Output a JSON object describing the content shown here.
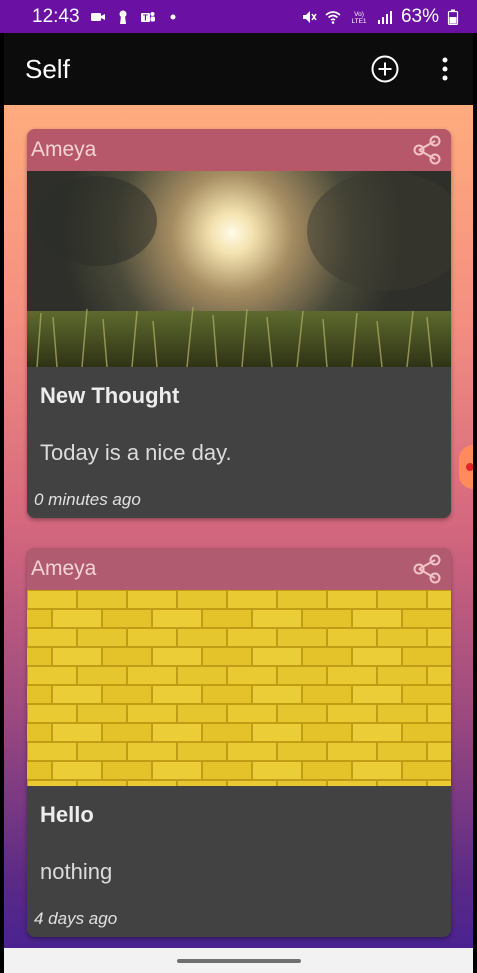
{
  "status_bar": {
    "time": "12:43",
    "battery": "63%",
    "icons": [
      "video-icon",
      "keyhole-icon",
      "teams-icon",
      "dot-icon",
      "mute-icon",
      "wifi-icon",
      "volte-icon",
      "signal-icon",
      "battery-icon"
    ]
  },
  "app_bar": {
    "title": "Self",
    "actions": [
      "add-circle-icon",
      "more-vert-icon"
    ]
  },
  "posts": [
    {
      "author": "Ameya",
      "image": "sunset-grass",
      "title": "New Thought",
      "text": "Today is a nice day.",
      "time": "0 minutes ago"
    },
    {
      "author": "Ameya",
      "image": "yellow-brick-wall",
      "title": "Hello",
      "text": "nothing",
      "time": "4 days ago"
    }
  ],
  "colors": {
    "status_bar": "#6a11a4",
    "app_bar": "#0c0c0c",
    "card": "#424242",
    "card_header": "#de6078"
  }
}
